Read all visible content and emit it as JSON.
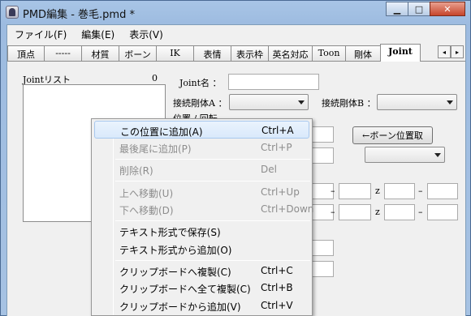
{
  "window": {
    "title": "PMD編集 - 巻毛.pmd *",
    "minimize_label": "▁",
    "maximize_label": "□",
    "close_label": "✕"
  },
  "menubar": [
    "ファイル(F)",
    "編集(E)",
    "表示(V)"
  ],
  "tabs": [
    {
      "label": "頂点",
      "active": false
    },
    {
      "label": "-----",
      "active": false
    },
    {
      "label": "材質",
      "active": false
    },
    {
      "label": "ボーン",
      "active": false
    },
    {
      "label": "IK",
      "active": false
    },
    {
      "label": "表情",
      "active": false
    },
    {
      "label": "表示枠",
      "active": false
    },
    {
      "label": "英名対応",
      "active": false
    },
    {
      "label": "Toon",
      "active": false
    },
    {
      "label": "剛体",
      "active": false
    },
    {
      "label": "Joint",
      "active": true
    }
  ],
  "tab_scroll": {
    "left": "◂",
    "right": "▸"
  },
  "joint_panel": {
    "list_label": "Jointリスト",
    "list_count": "0",
    "name_label": "Joint名 ：",
    "name_value": "",
    "body_a_label": "接続剛体A ：",
    "body_a_value": "",
    "body_b_label": "接続剛体B ：",
    "body_b_value": "",
    "pos_rot_label": "位置 / 回転",
    "bone_pos_button": "←ボーン位置取",
    "bone_select_value": "",
    "z_label": "z",
    "dash": "–"
  },
  "context_menu": {
    "items": [
      {
        "label": "この位置に追加(A)",
        "shortcut": "Ctrl+A",
        "enabled": true,
        "highlighted": true
      },
      {
        "label": "最後尾に追加(P)",
        "shortcut": "Ctrl+P",
        "enabled": false,
        "highlighted": false
      },
      {
        "label": "削除(R)",
        "shortcut": "Del",
        "enabled": false,
        "highlighted": false
      },
      {
        "label": "上へ移動(U)",
        "shortcut": "Ctrl+Up",
        "enabled": false,
        "highlighted": false
      },
      {
        "label": "下へ移動(D)",
        "shortcut": "Ctrl+Down",
        "enabled": false,
        "highlighted": false
      },
      {
        "label": "テキスト形式で保存(S)",
        "shortcut": "",
        "enabled": true,
        "highlighted": false
      },
      {
        "label": "テキスト形式から追加(O)",
        "shortcut": "",
        "enabled": true,
        "highlighted": false
      },
      {
        "label": "クリップボードへ複製(C)",
        "shortcut": "Ctrl+C",
        "enabled": true,
        "highlighted": false
      },
      {
        "label": "クリップボードへ全て複製(C)",
        "shortcut": "Ctrl+B",
        "enabled": true,
        "highlighted": false
      },
      {
        "label": "クリップボードから追加(V)",
        "shortcut": "Ctrl+V",
        "enabled": true,
        "highlighted": false
      }
    ]
  },
  "colors": {
    "titlebar": "#a8c5e6",
    "highlight": "#d9e9fb",
    "disabled_text": "#8d8d8d"
  }
}
